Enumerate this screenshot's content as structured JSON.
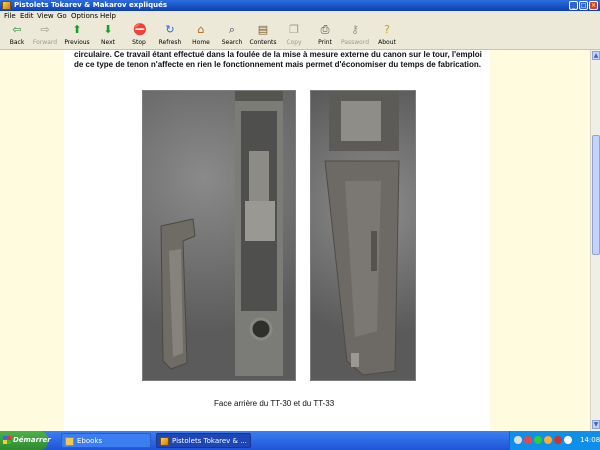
{
  "window": {
    "title": "Pistolets Tokarev & Makarov expliqués",
    "icon": "help-book-icon"
  },
  "menu": {
    "items": [
      "File",
      "Edit",
      "View",
      "Go",
      "Options",
      "Help"
    ]
  },
  "toolbar": {
    "buttons": [
      {
        "label": "Back",
        "icon": "back-arrow-icon",
        "enabled": true
      },
      {
        "label": "Forward",
        "icon": "forward-arrow-icon",
        "enabled": false
      },
      {
        "label": "Previous",
        "icon": "previous-arrow-icon",
        "enabled": true
      },
      {
        "label": "Next",
        "icon": "next-arrow-icon",
        "enabled": true
      },
      {
        "label": "Stop",
        "icon": "stop-icon",
        "enabled": true
      },
      {
        "label": "Refresh",
        "icon": "refresh-icon",
        "enabled": true
      },
      {
        "label": "Home",
        "icon": "home-icon",
        "enabled": true
      },
      {
        "label": "Search",
        "icon": "search-icon",
        "enabled": true
      },
      {
        "label": "Contents",
        "icon": "contents-icon",
        "enabled": true
      },
      {
        "label": "Copy",
        "icon": "copy-icon",
        "enabled": false
      },
      {
        "label": "Print",
        "icon": "print-icon",
        "enabled": true
      },
      {
        "label": "Password",
        "icon": "key-icon",
        "enabled": false
      },
      {
        "label": "About",
        "icon": "about-icon",
        "enabled": true
      }
    ]
  },
  "document": {
    "paragraph": "circulaire. Ce travail étant effectué dans la foulée de la mise à mesure externe du canon sur le tour, l'emploi de ce type de tenon n'affecte en rien le fonctionnement mais permet d'économiser du temps de fabrication.",
    "caption": "Face arrière du TT-30 et du TT-33"
  },
  "taskbar": {
    "start_label": "Démarrer",
    "tasks": [
      {
        "label": "Ebooks",
        "icon": "folder-icon",
        "active": false
      },
      {
        "label": "Pistolets Tokarev & ...",
        "icon": "help-book-icon",
        "active": true
      }
    ],
    "clock": "14:08"
  },
  "colors": {
    "titlebar": "#0a3fb3",
    "content_margin": "#fffbdf",
    "taskbar": "#1f54d6",
    "start": "#2f8a2e"
  }
}
